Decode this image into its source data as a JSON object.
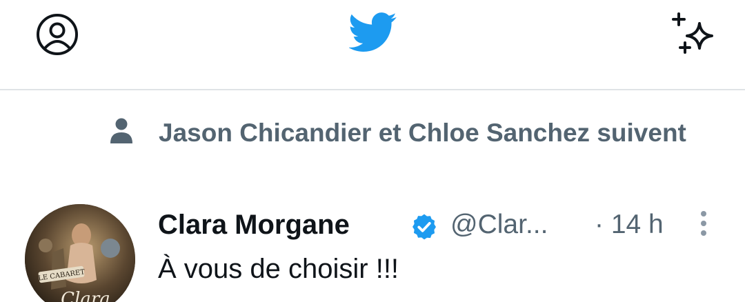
{
  "header": {
    "profile_icon": "profile-icon",
    "logo_icon": "twitter-bird-icon",
    "sparkle_icon": "sparkle-icon"
  },
  "social_context": {
    "icon": "person-icon",
    "text": "Jason Chicandier et Chloe Sanchez suivent"
  },
  "tweet": {
    "author_name": "Clara Morgane",
    "verified": true,
    "handle": "@Clar...",
    "time": "· 14 h",
    "text": "À vous de choisir !!!",
    "avatar_text_1": "LE CABARET",
    "avatar_text_2": "Clara"
  },
  "colors": {
    "brand": "#1d9bf0",
    "secondary_text": "#536471",
    "primary_text": "#0f1419",
    "divider": "#dfe3e6"
  }
}
